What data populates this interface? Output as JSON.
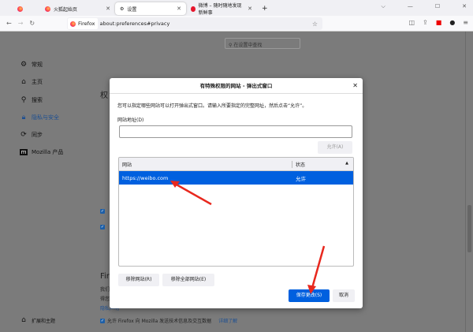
{
  "tabs": [
    {
      "label": "火狐起始页"
    },
    {
      "label": "设置"
    },
    {
      "label": "微博 – 随时随地发现新鲜事"
    }
  ],
  "toolbar": {
    "identity": "Firefox",
    "url": "about:preferences#privacy"
  },
  "search": {
    "placeholder": "在设置中查找"
  },
  "sidebar": {
    "items": [
      {
        "label": "常规"
      },
      {
        "label": "主页"
      },
      {
        "label": "搜索"
      },
      {
        "label": "隐私与安全"
      },
      {
        "label": "同步"
      },
      {
        "label": "Mozilla 产品"
      }
    ],
    "bottom": "扩展和主题"
  },
  "background": {
    "heading1": "权",
    "heading2": "Fire",
    "line1": "我们",
    "line2": "得您",
    "privacy_link": "隐私声明",
    "telemetry": "允许 Firefox 向 Mozilla 发送技术信息及交互数据",
    "learn_more": "详细了解"
  },
  "dialog": {
    "title": "有特殊权限的网站 - 弹出式窗口",
    "description": "您可以指定哪些网站可以打开弹出式窗口。请输入所要指定的完整网址，然后点击“允许”。",
    "address_label": "网站地址(D)",
    "address_value": "",
    "allow_button": "允许(A)",
    "columns": [
      "网站",
      "状态"
    ],
    "rows": [
      {
        "site": "https://weibo.com",
        "status": "允许"
      }
    ],
    "remove_site": "移除网站(R)",
    "remove_all": "移除全部网站(E)",
    "save": "保存更改(S)",
    "cancel": "取消"
  },
  "colors": {
    "accent": "#0060df",
    "annotation": "#e8281e"
  }
}
